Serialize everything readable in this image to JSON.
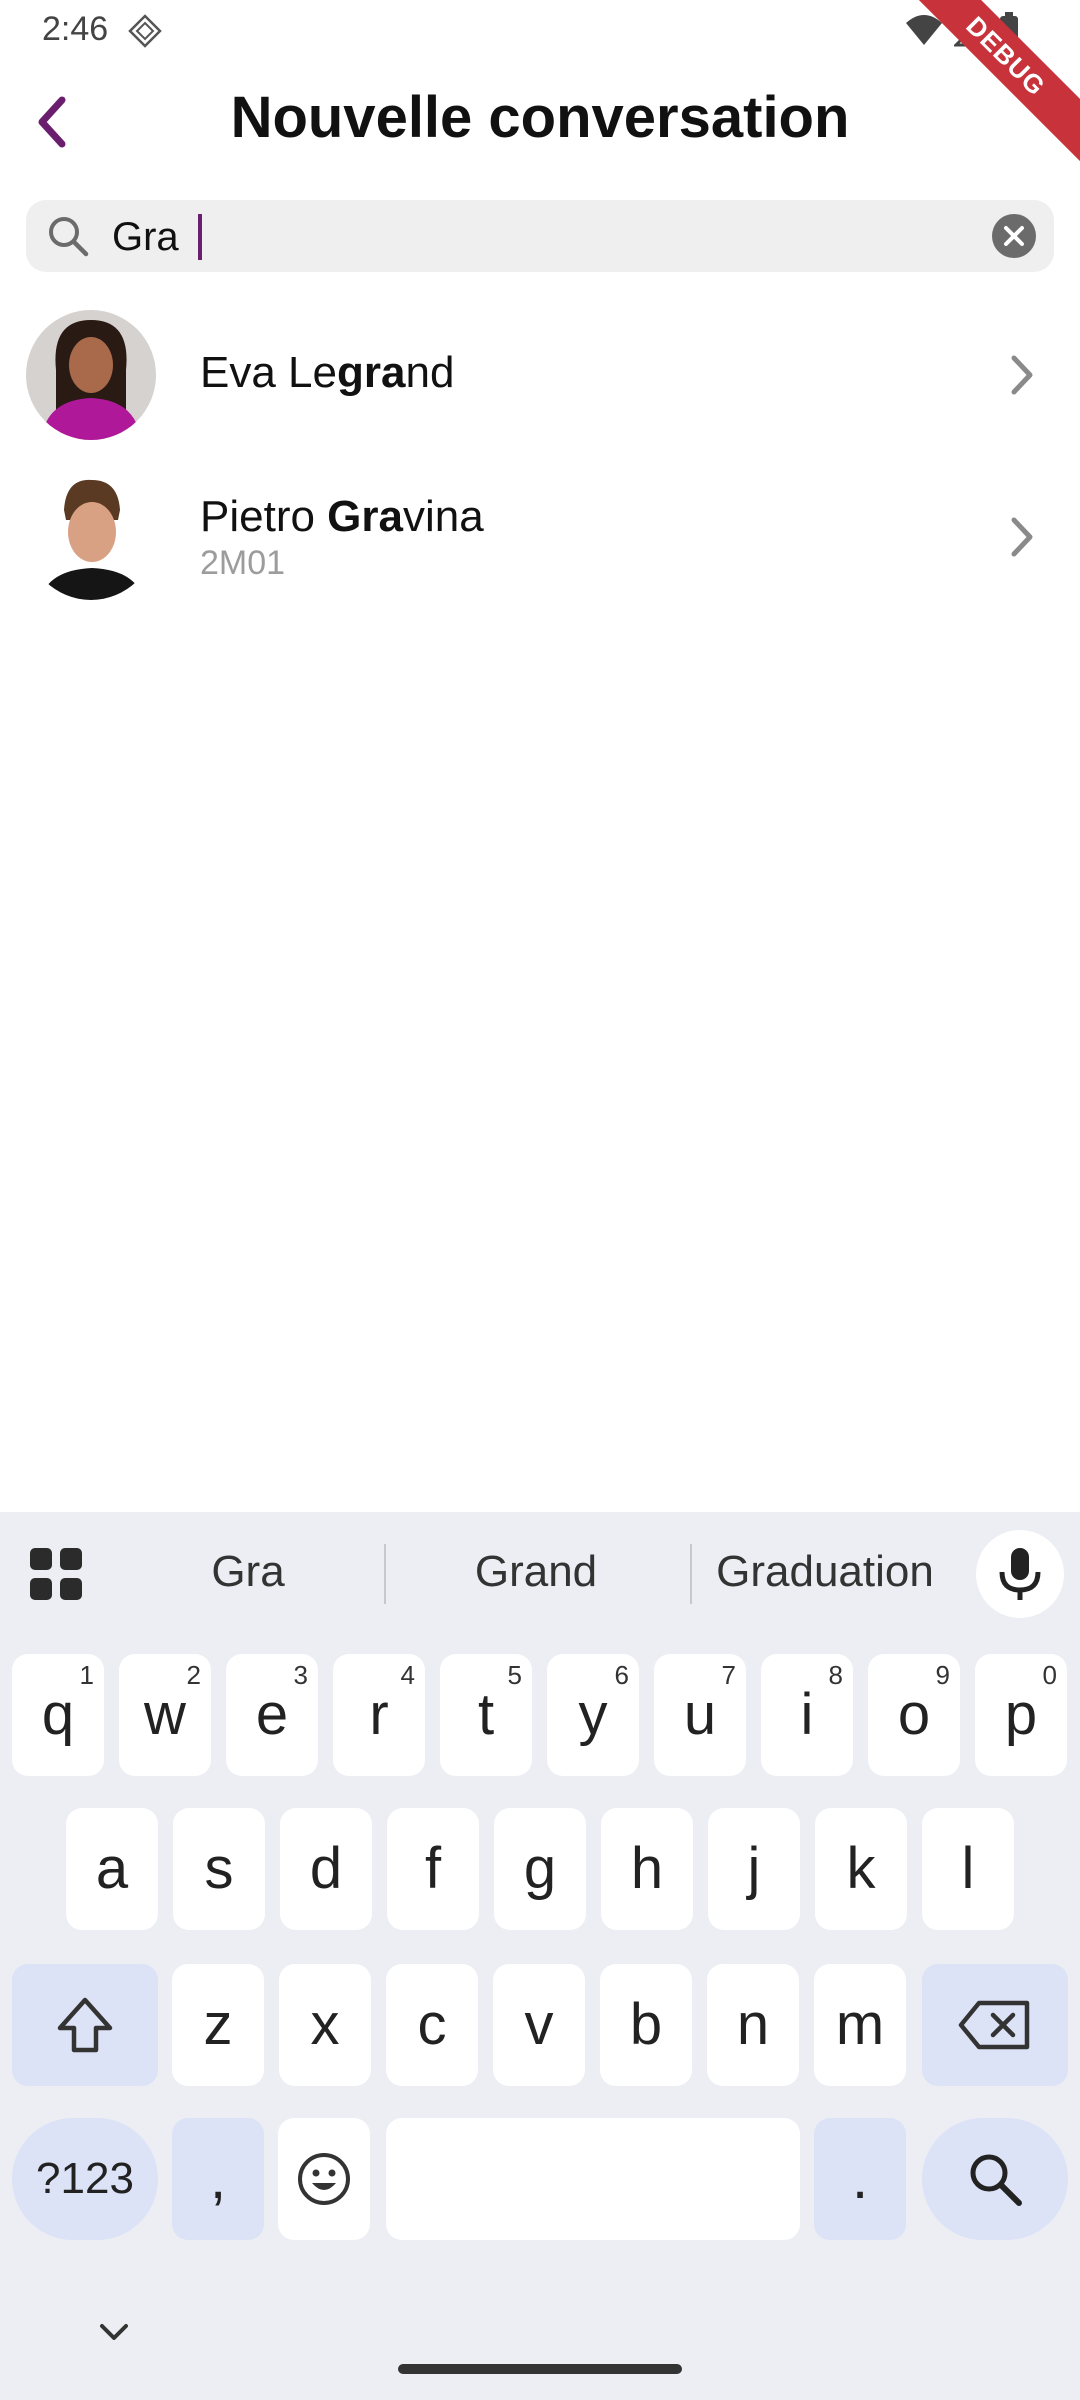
{
  "status_bar": {
    "time": "2:46",
    "debug_label": "DEBUG"
  },
  "header": {
    "title": "Nouvelle conversation"
  },
  "search": {
    "value": "Gra",
    "placeholder": ""
  },
  "results": [
    {
      "name_prefix": "Eva Le",
      "name_match": "gra",
      "name_suffix": "nd",
      "subtitle": ""
    },
    {
      "name_prefix": "Pietro ",
      "name_match": "Gra",
      "name_suffix": "vina",
      "subtitle": "2M01"
    }
  ],
  "keyboard": {
    "suggestions": [
      "Gra",
      "Grand",
      "Graduation"
    ],
    "row1": [
      {
        "k": "q",
        "h": "1"
      },
      {
        "k": "w",
        "h": "2"
      },
      {
        "k": "e",
        "h": "3"
      },
      {
        "k": "r",
        "h": "4"
      },
      {
        "k": "t",
        "h": "5"
      },
      {
        "k": "y",
        "h": "6"
      },
      {
        "k": "u",
        "h": "7"
      },
      {
        "k": "i",
        "h": "8"
      },
      {
        "k": "o",
        "h": "9"
      },
      {
        "k": "p",
        "h": "0"
      }
    ],
    "row2": [
      "a",
      "s",
      "d",
      "f",
      "g",
      "h",
      "j",
      "k",
      "l"
    ],
    "row3": [
      "z",
      "x",
      "c",
      "v",
      "b",
      "n",
      "m"
    ],
    "symbols_label": "?123",
    "comma": ",",
    "period": "."
  },
  "colors": {
    "accent": "#6a1e6e",
    "keyboard_bg": "#eceef4",
    "mod_key": "#dce3f6"
  }
}
